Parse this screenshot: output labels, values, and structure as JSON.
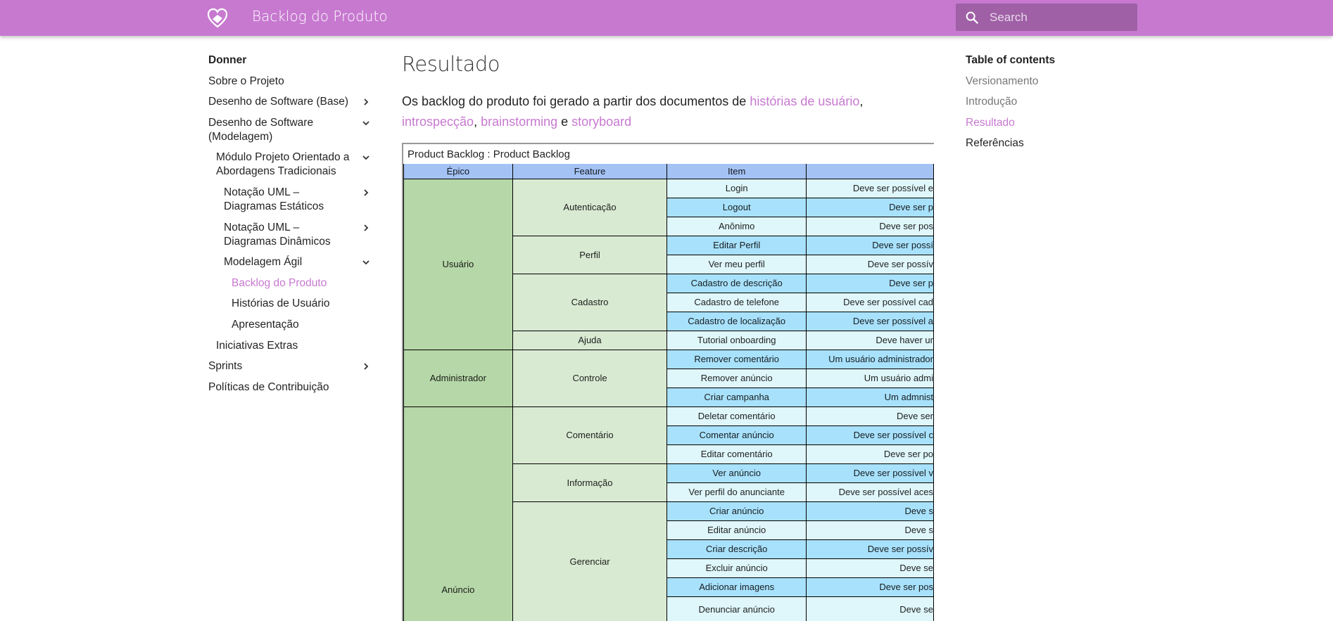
{
  "header": {
    "title": "Backlog do Produto",
    "search_placeholder": "Search",
    "accent": "#c779d0"
  },
  "sidebar": {
    "items": [
      {
        "label": "Donner",
        "level": 0,
        "bold": true
      },
      {
        "label": "Sobre o Projeto",
        "level": 0
      },
      {
        "label": "Desenho de Software (Base)",
        "level": 0,
        "chevron": "right"
      },
      {
        "label": "Desenho de Software (Modelagem)",
        "level": 0,
        "chevron": "down"
      },
      {
        "label": "Módulo Projeto Orientado a Abordagens Tradicionais",
        "level": 1,
        "chevron": "down"
      },
      {
        "label": "Notação UML – Diagramas Estáticos",
        "level": 2,
        "chevron": "right"
      },
      {
        "label": "Notação UML – Diagramas Dinâmicos",
        "level": 2,
        "chevron": "right"
      },
      {
        "label": "Modelagem Ágil",
        "level": 2,
        "chevron": "down"
      },
      {
        "label": "Backlog do Produto",
        "level": 3,
        "active": true
      },
      {
        "label": "Histórias de Usuário",
        "level": 3
      },
      {
        "label": "Apresentação",
        "level": 3
      },
      {
        "label": "Iniciativas Extras",
        "level": 1
      },
      {
        "label": "Sprints",
        "level": 0,
        "chevron": "right"
      },
      {
        "label": "Políticas de Contribuição",
        "level": 0
      }
    ]
  },
  "main": {
    "heading": "Resultado",
    "intro": {
      "t1": "Os backlog do produto foi gerado a partir dos documentos de ",
      "l1": "histórias de usuário",
      "t2": ", ",
      "l2": "introspecção",
      "t3": ", ",
      "l3": "brainstorming",
      "t4": " e ",
      "l4": "storyboard"
    },
    "table": {
      "caption": "Product Backlog : Product Backlog",
      "headers": [
        "Épico",
        "Feature",
        "Item",
        ""
      ],
      "epics": [
        {
          "name": "Usuário",
          "features": [
            {
              "name": "Autenticação",
              "items": [
                [
                  "Login",
                  "Deve ser possível e"
                ],
                [
                  "Logout",
                  "Deve ser p"
                ],
                [
                  "Anônimo",
                  "Deve ser pos"
                ]
              ]
            },
            {
              "name": "Perfil",
              "items": [
                [
                  "Editar Perfil",
                  "Deve ser possí"
                ],
                [
                  "Ver meu perfil",
                  "Deve ser possív"
                ]
              ]
            },
            {
              "name": "Cadastro",
              "items": [
                [
                  "Cadastro de descrição",
                  "Deve ser p"
                ],
                [
                  "Cadastro de telefone",
                  "Deve ser possível cad"
                ],
                [
                  "Cadastro de localização",
                  "Deve ser possível a"
                ]
              ]
            },
            {
              "name": "Ajuda",
              "items": [
                [
                  "Tutorial onboarding",
                  "Deve haver ur"
                ]
              ]
            }
          ]
        },
        {
          "name": "Administrador",
          "features": [
            {
              "name": "Controle",
              "items": [
                [
                  "Remover comentário",
                  "Um usuário administrador"
                ],
                [
                  "Remover anúncio",
                  "Um usuário admi"
                ],
                [
                  "Criar campanha",
                  "Um admnist"
                ]
              ]
            }
          ]
        },
        {
          "name": "Anúncio",
          "features": [
            {
              "name": "Comentário",
              "items": [
                [
                  "Deletar comentário",
                  "Deve ser"
                ],
                [
                  "Comentar anúncio",
                  "Deve ser possível c"
                ],
                [
                  "Editar comentário",
                  "Deve ser po"
                ]
              ]
            },
            {
              "name": "Informação",
              "items": [
                [
                  "Ver anúncio",
                  "Deve ser possível v"
                ],
                [
                  "Ver perfil do anunciante",
                  "Deve ser possível aces"
                ]
              ]
            },
            {
              "name": "Gerenciar",
              "items": [
                [
                  "Criar anúncio",
                  "Deve s"
                ],
                [
                  "Editar anúncio",
                  "Deve s"
                ],
                [
                  "Criar descrição",
                  "Deve ser possív"
                ],
                [
                  "Excluir anúncio",
                  "Deve se"
                ],
                [
                  "Adicionar imagens",
                  "Deve ser pos"
                ],
                [
                  "Denunciar anúncio",
                  "Deve se"
                ]
              ]
            }
          ]
        }
      ],
      "colors": {
        "header": "#a4c2f4",
        "epic": "#b6d7a8",
        "feature": "#d9ead3",
        "item_light": "#dff6fa",
        "item_dark": "#a8e1fb"
      }
    }
  },
  "toc": {
    "title": "Table of contents",
    "items": [
      {
        "label": "Versionamento"
      },
      {
        "label": "Introdução"
      },
      {
        "label": "Resultado",
        "active": true
      },
      {
        "label": "Referências",
        "visited": true
      }
    ]
  }
}
